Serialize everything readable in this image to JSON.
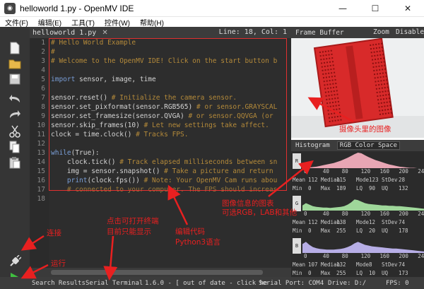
{
  "window": {
    "title": "helloworld 1.py - OpenMV IDE",
    "minimize": "—",
    "maximize": "☐",
    "close": "✕"
  },
  "menu": [
    "文件(F)",
    "编辑(E)",
    "工具(T)",
    "控件(W)",
    "帮助(H)"
  ],
  "editor": {
    "filename": "helloworld 1.py",
    "close": "✕",
    "position": "Line: 18, Col: 1",
    "line_numbers": [
      "1",
      "2",
      "3",
      "4",
      "5",
      "6",
      "7",
      "8",
      "9",
      "10",
      "11",
      "12",
      "13",
      "14",
      "15",
      "16",
      "17",
      "18"
    ],
    "lines": [
      [
        {
          "t": "# Hello World Example",
          "c": "comment"
        }
      ],
      [
        {
          "t": "#",
          "c": "comment"
        }
      ],
      [
        {
          "t": "# Welcome to the OpenMV IDE! Click on the start button b",
          "c": "comment"
        }
      ],
      [
        {
          "t": "",
          "c": "normal"
        }
      ],
      [
        {
          "t": "import",
          "c": "kw"
        },
        {
          "t": " sensor, image, time",
          "c": "normal"
        }
      ],
      [
        {
          "t": "",
          "c": "normal"
        }
      ],
      [
        {
          "t": "sensor.reset() ",
          "c": "normal"
        },
        {
          "t": "# Initialize the camera sensor.",
          "c": "comment"
        }
      ],
      [
        {
          "t": "sensor.set_pixformat(sensor.RGB565) ",
          "c": "normal"
        },
        {
          "t": "# or sensor.GRAYSCAL",
          "c": "comment"
        }
      ],
      [
        {
          "t": "sensor.set_framesize(sensor.QVGA) ",
          "c": "normal"
        },
        {
          "t": "# or sensor.QQVGA (or",
          "c": "comment"
        }
      ],
      [
        {
          "t": "sensor.skip_frames(10) ",
          "c": "normal"
        },
        {
          "t": "# Let new settings take affect.",
          "c": "comment"
        }
      ],
      [
        {
          "t": "clock = time.clock() ",
          "c": "normal"
        },
        {
          "t": "# Tracks FPS.",
          "c": "comment"
        }
      ],
      [
        {
          "t": "",
          "c": "normal"
        }
      ],
      [
        {
          "t": "while",
          "c": "kw"
        },
        {
          "t": "(True):",
          "c": "normal"
        }
      ],
      [
        {
          "t": "    clock.tick() ",
          "c": "normal"
        },
        {
          "t": "# Track elapsed milliseconds between sn",
          "c": "comment"
        }
      ],
      [
        {
          "t": "    img = sensor.snapshot() ",
          "c": "normal"
        },
        {
          "t": "# Take a picture and return",
          "c": "comment"
        }
      ],
      [
        {
          "t": "    ",
          "c": "normal"
        },
        {
          "t": "print",
          "c": "kw"
        },
        {
          "t": "(clock.fps()) ",
          "c": "normal"
        },
        {
          "t": "# Note: Your OpenMV Cam runs abou",
          "c": "comment"
        }
      ],
      [
        {
          "t": "    # connected to your computer. The FPS should increas",
          "c": "dim"
        }
      ],
      [
        {
          "t": "",
          "c": "normal"
        }
      ]
    ]
  },
  "framebuffer": {
    "title": "Frame Buffer",
    "zoom": "Zoom",
    "disable": "Disable"
  },
  "histogram": {
    "title": "Histogram",
    "colorspace": "RGB Color Space",
    "ticks": [
      "0",
      "40",
      "80",
      "120",
      "160",
      "200",
      "240"
    ],
    "channels": [
      {
        "label": "R",
        "color": "#e8a6b4",
        "row1": [
          "Mean",
          "112",
          "Median",
          "115",
          "Mode",
          "123",
          "StDev",
          "28"
        ],
        "row2": [
          "Min",
          "0",
          "Max",
          "189",
          "LQ",
          "90",
          "UQ",
          "132"
        ],
        "curve": [
          0,
          1,
          2,
          3,
          4,
          6,
          8,
          10,
          12,
          14,
          17,
          20,
          24,
          28,
          33,
          38,
          42,
          40,
          35,
          30,
          26,
          22,
          19,
          16,
          13,
          10,
          8,
          6,
          4,
          3,
          2,
          1,
          1,
          0,
          0,
          0
        ]
      },
      {
        "label": "G",
        "color": "#9fd79a",
        "row1": [
          "Mean",
          "112",
          "Median",
          "138",
          "Mode",
          "12",
          "StDev",
          "74"
        ],
        "row2": [
          "Min",
          "0",
          "Max",
          "255",
          "LQ",
          "20",
          "UQ",
          "178"
        ],
        "curve": [
          14,
          20,
          16,
          12,
          10,
          9,
          8,
          8,
          7,
          8,
          9,
          10,
          12,
          16,
          22,
          30,
          28,
          24,
          20,
          18,
          17,
          16,
          15,
          14,
          14,
          13,
          13,
          12,
          12,
          11,
          10,
          9,
          8,
          7,
          6,
          5
        ]
      },
      {
        "label": "B",
        "color": "#b7aee6",
        "row1": [
          "Mean",
          "107",
          "Median",
          "132",
          "Mode",
          "8",
          "StDev",
          "74"
        ],
        "row2": [
          "Min",
          "0",
          "Max",
          "255",
          "LQ",
          "10",
          "UQ",
          "173"
        ],
        "curve": [
          24,
          30,
          22,
          16,
          13,
          11,
          10,
          9,
          9,
          9,
          10,
          11,
          13,
          16,
          20,
          26,
          30,
          26,
          22,
          20,
          18,
          17,
          16,
          15,
          14,
          13,
          12,
          12,
          11,
          10,
          9,
          8,
          7,
          6,
          5,
          4
        ]
      }
    ]
  },
  "status": {
    "search_results": "Search Results",
    "serial_terminal": "Serial Terminal",
    "version": "1.6.0 - [ out of date - click he",
    "serial_port": "Serial Port: COM4",
    "drive": "Drive: D:/",
    "fps": "FPS: 0"
  },
  "annotations": {
    "camera_image": "摄像头里的图像",
    "histogram_info_1": "图像信息的图表",
    "histogram_info_2": "可选RGB，LAB和其他",
    "edit_code_1": "编辑代码",
    "edit_code_2": "Python3语言",
    "terminal_1": "点击可打开终端",
    "terminal_2": "目前只能显示",
    "connect": "连接",
    "run": "运行",
    "color": "#e82020"
  }
}
